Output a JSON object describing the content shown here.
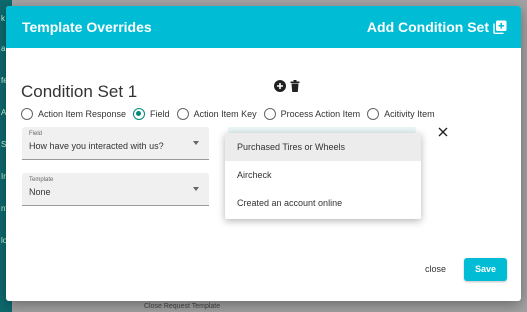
{
  "background": {
    "sidebar_letters": [
      "k",
      "a",
      "fe",
      "A",
      "S",
      "In",
      "nt",
      "lo"
    ],
    "bottom_text": "Close Request Template"
  },
  "dialog": {
    "title": "Template Overrides",
    "add_condition_label": "Add Condition Set",
    "condition_set_title": "Condition Set 1",
    "radio_options": [
      {
        "label": "Action Item Response",
        "checked": false
      },
      {
        "label": "Field",
        "checked": true
      },
      {
        "label": "Action Item Key",
        "checked": false
      },
      {
        "label": "Process Action Item",
        "checked": false
      },
      {
        "label": "Acitivity Item",
        "checked": false
      }
    ],
    "field_select": {
      "label": "Field",
      "value": "How have you interacted with us?"
    },
    "template_select": {
      "label": "Template",
      "value": "None"
    },
    "dropdown_options": [
      "Purchased Tires or Wheels",
      "Aircheck",
      "Created an account online"
    ],
    "close_label": "close",
    "save_label": "Save"
  },
  "colors": {
    "accent": "#00bcd4",
    "radio_checked": "#00897b"
  }
}
